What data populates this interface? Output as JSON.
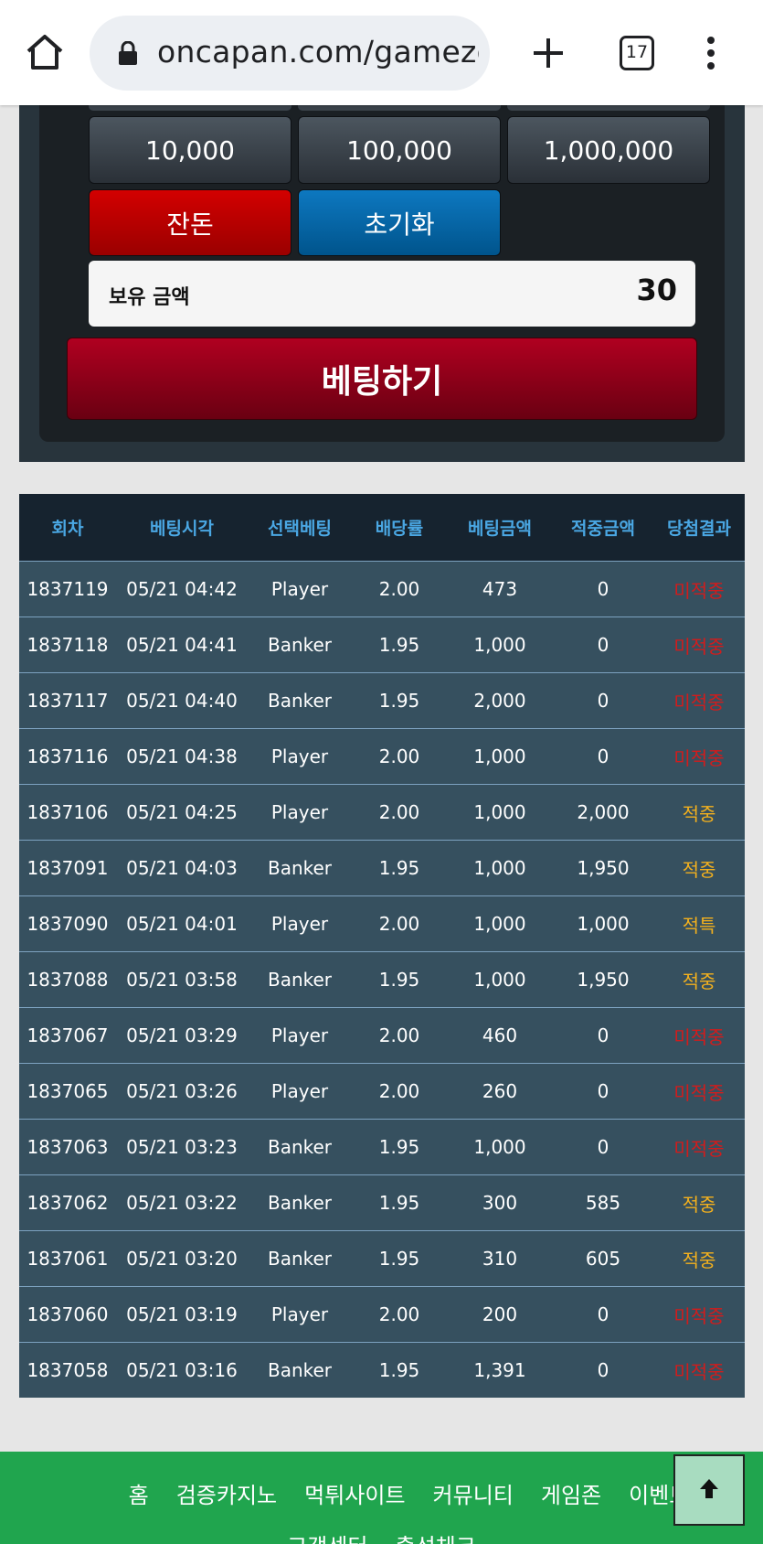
{
  "browser": {
    "url": "oncapan.com/gamezo",
    "tab_count": "17"
  },
  "chips": {
    "row1": [
      "10,000",
      "100,000",
      "1,000,000"
    ]
  },
  "actions": {
    "balance_label": "잔돈",
    "reset_label": "초기화",
    "bet_label": "베팅하기"
  },
  "amount": {
    "label": "보유 금액",
    "value": "30"
  },
  "history": {
    "headers": [
      "회차",
      "베팅시각",
      "선택베팅",
      "배당률",
      "베팅금액",
      "적중금액",
      "당첨결과"
    ],
    "rows": [
      [
        "1837119",
        "05/21 04:42",
        "Player",
        "2.00",
        "473",
        "0",
        "미적중"
      ],
      [
        "1837118",
        "05/21 04:41",
        "Banker",
        "1.95",
        "1,000",
        "0",
        "미적중"
      ],
      [
        "1837117",
        "05/21 04:40",
        "Banker",
        "1.95",
        "2,000",
        "0",
        "미적중"
      ],
      [
        "1837116",
        "05/21 04:38",
        "Player",
        "2.00",
        "1,000",
        "0",
        "미적중"
      ],
      [
        "1837106",
        "05/21 04:25",
        "Player",
        "2.00",
        "1,000",
        "2,000",
        "적중"
      ],
      [
        "1837091",
        "05/21 04:03",
        "Banker",
        "1.95",
        "1,000",
        "1,950",
        "적중"
      ],
      [
        "1837090",
        "05/21 04:01",
        "Player",
        "2.00",
        "1,000",
        "1,000",
        "적특"
      ],
      [
        "1837088",
        "05/21 03:58",
        "Banker",
        "1.95",
        "1,000",
        "1,950",
        "적중"
      ],
      [
        "1837067",
        "05/21 03:29",
        "Player",
        "2.00",
        "460",
        "0",
        "미적중"
      ],
      [
        "1837065",
        "05/21 03:26",
        "Player",
        "2.00",
        "260",
        "0",
        "미적중"
      ],
      [
        "1837063",
        "05/21 03:23",
        "Banker",
        "1.95",
        "1,000",
        "0",
        "미적중"
      ],
      [
        "1837062",
        "05/21 03:22",
        "Banker",
        "1.95",
        "300",
        "585",
        "적중"
      ],
      [
        "1837061",
        "05/21 03:20",
        "Banker",
        "1.95",
        "310",
        "605",
        "적중"
      ],
      [
        "1837060",
        "05/21 03:19",
        "Player",
        "2.00",
        "200",
        "0",
        "미적중"
      ],
      [
        "1837058",
        "05/21 03:16",
        "Banker",
        "1.95",
        "1,391",
        "0",
        "미적중"
      ]
    ]
  },
  "footer": {
    "nav": [
      "홈",
      "검증카지노",
      "먹튀사이트",
      "커뮤니티",
      "게임존",
      "이벤트"
    ],
    "nav2": [
      "고객센터",
      "출석체크"
    ]
  },
  "colors": {
    "lose": "#d21c1c",
    "win": "#f2b01e",
    "footer": "#20a54e"
  }
}
